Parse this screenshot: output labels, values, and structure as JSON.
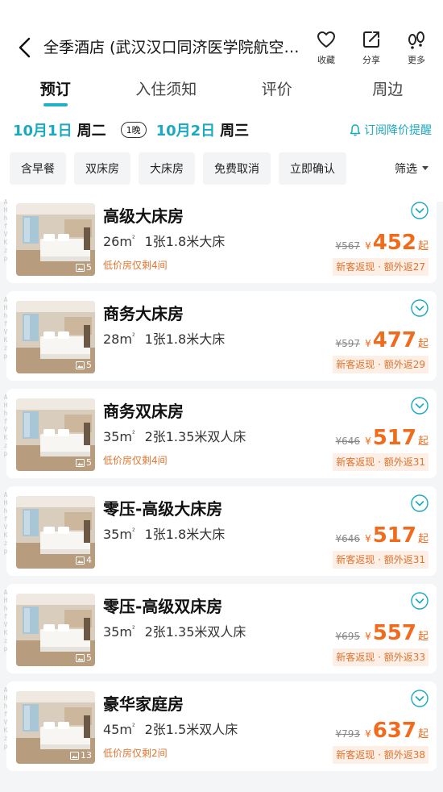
{
  "header": {
    "title": "全季酒店 (武汉汉口同济医学院航空路地铁站店)",
    "actions": [
      {
        "label": "收藏",
        "icon": "heart-icon"
      },
      {
        "label": "分享",
        "icon": "share-icon"
      },
      {
        "label": "更多",
        "icon": "footprint-icon"
      }
    ]
  },
  "tabs": [
    {
      "label": "预订",
      "active": true
    },
    {
      "label": "入住须知",
      "active": false
    },
    {
      "label": "评价",
      "active": false
    },
    {
      "label": "周边",
      "active": false
    }
  ],
  "dates": {
    "checkin": "10月1日",
    "checkin_weekday": "周二",
    "nights": "1晚",
    "checkout": "10月2日",
    "checkout_weekday": "周三",
    "alert": "订阅降价提醒"
  },
  "filters": [
    "含早餐",
    "双床房",
    "大床房",
    "免费取消",
    "立即确认"
  ],
  "sort_label": "筛选",
  "colors": {
    "accent": "#1ba9c0",
    "price": "#f06b1c",
    "note": "#e0752f"
  },
  "rooms": [
    {
      "name": "高级大床房",
      "area": "26m",
      "bed": "1张1.8米大床",
      "note": "低价房仅剩4间",
      "old_price": "¥567",
      "currency": "¥",
      "price": "452",
      "suffix": "起",
      "promo": "新客返现 · 额外返27",
      "photos": "5"
    },
    {
      "name": "商务大床房",
      "area": "28m",
      "bed": "1张1.8米大床",
      "note": "",
      "old_price": "¥597",
      "currency": "¥",
      "price": "477",
      "suffix": "起",
      "promo": "新客返现 · 额外返29",
      "photos": "5"
    },
    {
      "name": "商务双床房",
      "area": "35m",
      "bed": "2张1.35米双人床",
      "note": "低价房仅剩4间",
      "old_price": "¥646",
      "currency": "¥",
      "price": "517",
      "suffix": "起",
      "promo": "新客返现 · 额外返31",
      "photos": "5"
    },
    {
      "name": "零压-高级大床房",
      "area": "35m",
      "bed": "1张1.8米大床",
      "note": "",
      "old_price": "¥646",
      "currency": "¥",
      "price": "517",
      "suffix": "起",
      "promo": "新客返现 · 额外返31",
      "photos": "4"
    },
    {
      "name": "零压-高级双床房",
      "area": "35m",
      "bed": "2张1.35米双人床",
      "note": "",
      "old_price": "¥695",
      "currency": "¥",
      "price": "557",
      "suffix": "起",
      "promo": "新客返现 · 额外返33",
      "photos": "5"
    },
    {
      "name": "豪华家庭房",
      "area": "45m",
      "bed": "2张1.5米双人床",
      "note": "低价房仅剩2间",
      "old_price": "¥793",
      "currency": "¥",
      "price": "637",
      "suffix": "起",
      "promo": "新客返现 · 额外返38",
      "photos": "13"
    }
  ],
  "area_unit": "²"
}
